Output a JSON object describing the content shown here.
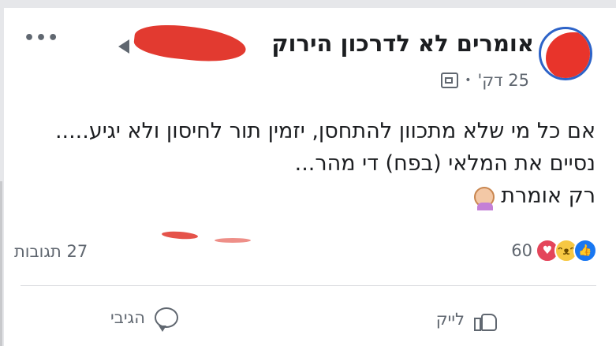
{
  "post": {
    "group_name": "אומרים לא לדרכון הירוק",
    "time": "25 דק'",
    "lines": [
      "אם כל מי שלא מתכוון להתחסן, יזמין תור לחיסון ולא יגיע.....",
      "נסיים את המלאי (בפח) די מהר...",
      "רק אומרת"
    ]
  },
  "stats": {
    "reaction_count": "60",
    "comments_label": "27 תגובות"
  },
  "actions": {
    "like_label": "לייק",
    "comment_label": "הגיבי"
  },
  "icons": [
    "more-icon",
    "avatar",
    "photo-icon",
    "woman-emoji-icon",
    "love-reaction-icon",
    "haha-reaction-icon",
    "like-reaction-icon",
    "thumb-up-icon",
    "comment-bubble-icon"
  ],
  "colors": {
    "like_blue": "#1877f2",
    "love_red": "#e4455a",
    "haha_yellow": "#f7c843",
    "meta_gray": "#606770",
    "redaction_red": "#e23a30"
  }
}
